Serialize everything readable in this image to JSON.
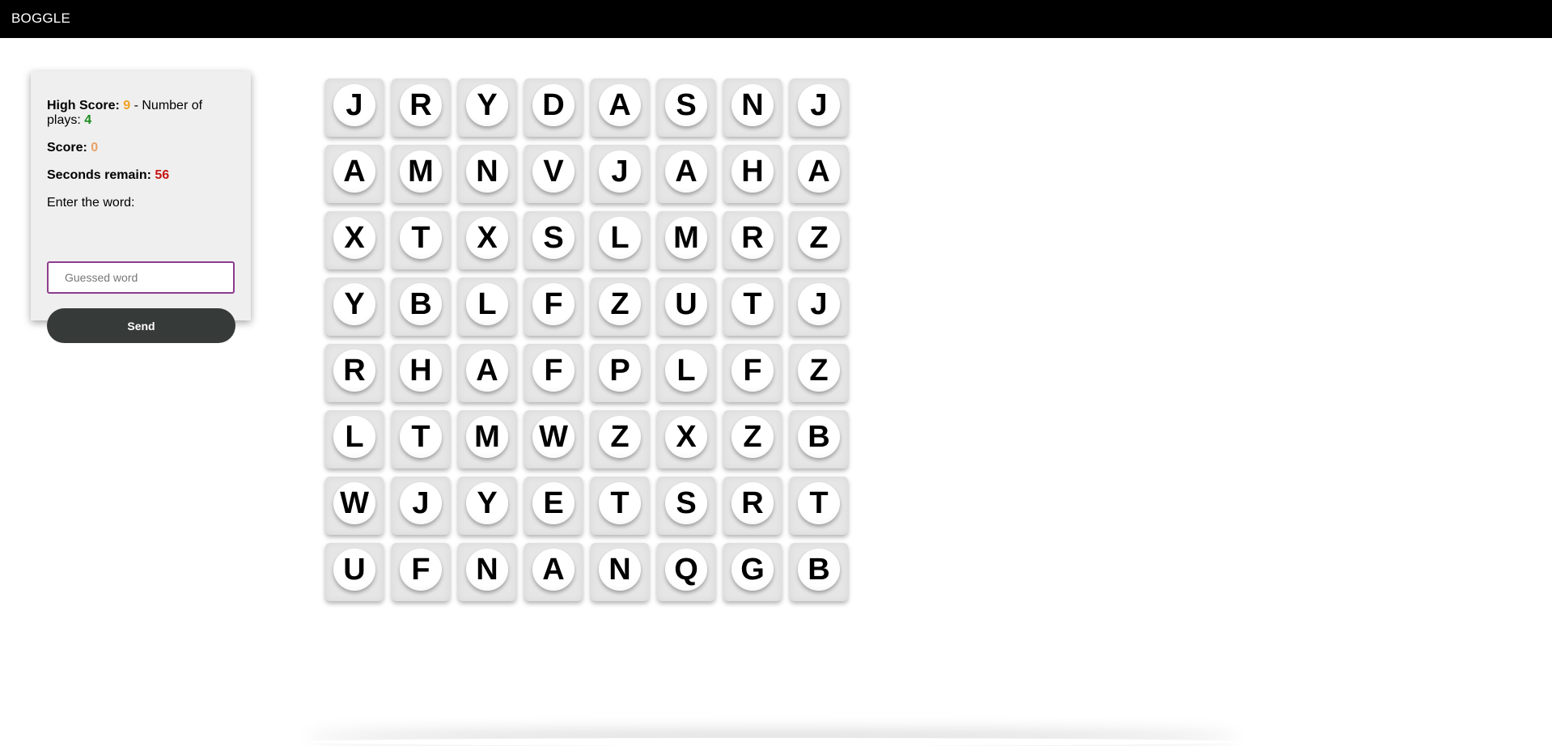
{
  "navbar": {
    "brand": "BOGGLE"
  },
  "panel": {
    "high_score_label": "High Score:",
    "high_score_value": "9",
    "plays_separator": " - Number of plays: ",
    "plays_value": "4",
    "score_label": "Score:",
    "score_value": "0",
    "seconds_label": "Seconds remain:",
    "seconds_value": "56",
    "enter_label": "Enter the word:",
    "input_placeholder": "Guessed word",
    "input_value": "",
    "send_label": "Send"
  },
  "colors": {
    "navbar_bg": "#000000",
    "panel_bg": "#efefef",
    "high_score": "#f0a020",
    "plays": "#1d8a1d",
    "score": "#e8a064",
    "seconds": "#c81414",
    "input_border": "#8e3c8e",
    "send_button_bg": "#363a38"
  },
  "board": {
    "rows": [
      [
        "J",
        "R",
        "Y",
        "D",
        "A",
        "S",
        "N",
        "J"
      ],
      [
        "A",
        "M",
        "N",
        "V",
        "J",
        "A",
        "H",
        "A"
      ],
      [
        "X",
        "T",
        "X",
        "S",
        "L",
        "M",
        "R",
        "Z"
      ],
      [
        "Y",
        "B",
        "L",
        "F",
        "Z",
        "U",
        "T",
        "J"
      ],
      [
        "R",
        "H",
        "A",
        "F",
        "P",
        "L",
        "F",
        "Z"
      ],
      [
        "L",
        "T",
        "M",
        "W",
        "Z",
        "X",
        "Z",
        "B"
      ],
      [
        "W",
        "J",
        "Y",
        "E",
        "T",
        "S",
        "R",
        "T"
      ],
      [
        "U",
        "F",
        "N",
        "A",
        "N",
        "Q",
        "G",
        "B"
      ]
    ]
  }
}
